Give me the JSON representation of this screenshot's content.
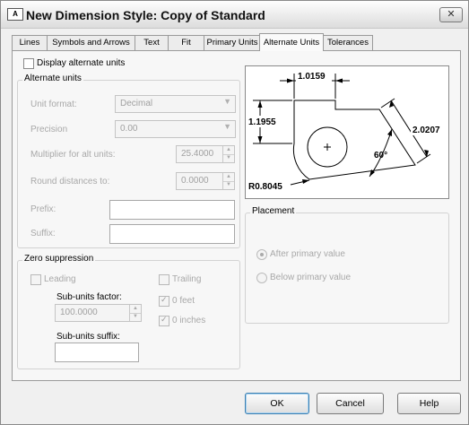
{
  "window": {
    "title": "New Dimension Style: Copy of Standard",
    "app_icon_text": "A",
    "close_glyph": "✕"
  },
  "tabs": [
    {
      "label": "Lines",
      "active": false
    },
    {
      "label": "Symbols and Arrows",
      "active": false
    },
    {
      "label": "Text",
      "active": false
    },
    {
      "label": "Fit",
      "active": false
    },
    {
      "label": "Primary Units",
      "active": false
    },
    {
      "label": "Alternate Units",
      "active": true
    },
    {
      "label": "Tolerances",
      "active": false
    }
  ],
  "display_alt": {
    "label": "Display alternate units",
    "checked": false
  },
  "alt_units": {
    "legend": "Alternate units",
    "unit_format": {
      "label": "Unit format:",
      "value": "Decimal"
    },
    "precision": {
      "label": "Precision",
      "value": "0.00"
    },
    "multiplier": {
      "label": "Multiplier for alt units:",
      "value": "25.4000"
    },
    "round": {
      "label": "Round distances  to:",
      "value": "0.0000"
    },
    "prefix": {
      "label": "Prefix:",
      "value": ""
    },
    "suffix": {
      "label": "Suffix:",
      "value": ""
    }
  },
  "zero": {
    "legend": "Zero suppression",
    "leading": {
      "label": "Leading",
      "checked": false
    },
    "subunits_factor": {
      "label": "Sub-units factor:",
      "value": "100.0000"
    },
    "subunits_suffix": {
      "label": "Sub-units suffix:",
      "value": ""
    },
    "trailing": {
      "label": "Trailing",
      "checked": false
    },
    "zero_feet": {
      "label": "0 feet",
      "checked": true
    },
    "zero_inches": {
      "label": "0 inches",
      "checked": true
    }
  },
  "preview": {
    "dim_top": "1.0159",
    "dim_left": "1.1955",
    "dim_diag": "2.0207",
    "angle": "60°",
    "radius": "R0.8045"
  },
  "placement": {
    "legend": "Placement",
    "after": {
      "label": "After primary value",
      "selected": true
    },
    "below": {
      "label": "Below primary value",
      "selected": false
    }
  },
  "buttons": {
    "ok": "OK",
    "cancel": "Cancel",
    "help": "Help"
  }
}
